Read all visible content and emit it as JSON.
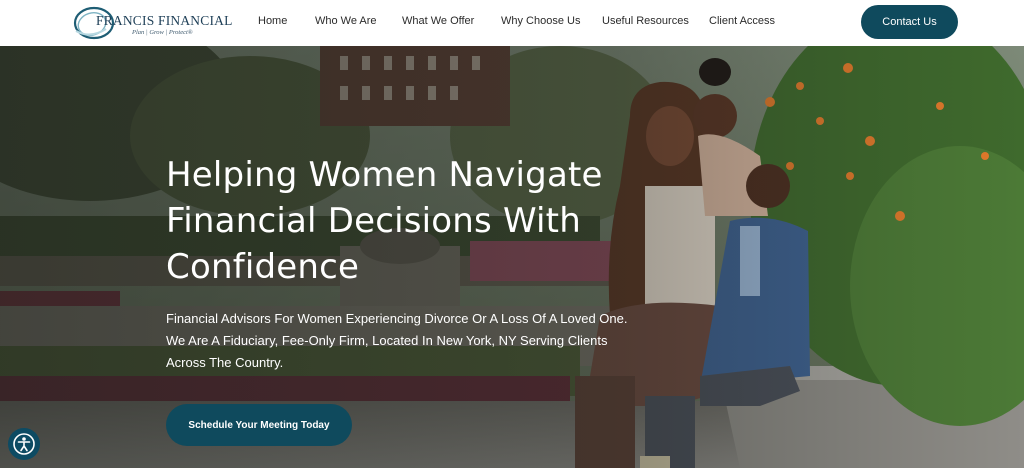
{
  "header": {
    "logo": {
      "name": "FRANCIS FINANCIAL",
      "tagline": "Plan | Grow | Protect®",
      "icon": "logo-swirl-icon"
    },
    "nav": [
      {
        "label": "Home"
      },
      {
        "label": "Who We Are"
      },
      {
        "label": "What We Offer"
      },
      {
        "label": "Why Choose Us"
      },
      {
        "label": "Useful Resources"
      },
      {
        "label": "Client Access"
      }
    ],
    "cta_label": "Contact Us"
  },
  "hero": {
    "title": "Helping Women Navigate Financial Decisions With Confidence",
    "subtitle": "Financial Advisors For Women Experiencing Divorce Or A Loss Of A Loved One. We Are A Fiduciary, Fee-Only Firm, Located In New York, NY Serving Clients Across The Country.",
    "cta_label": "Schedule Your Meeting Today",
    "image_description": "mother-and-children-in-park-photo"
  },
  "accessibility": {
    "icon": "accessibility-icon"
  },
  "colors": {
    "brand_teal": "#0f4a5d",
    "accessibility_blue": "#0d4b63",
    "text_dark": "#2b2b2b",
    "white": "#ffffff"
  }
}
